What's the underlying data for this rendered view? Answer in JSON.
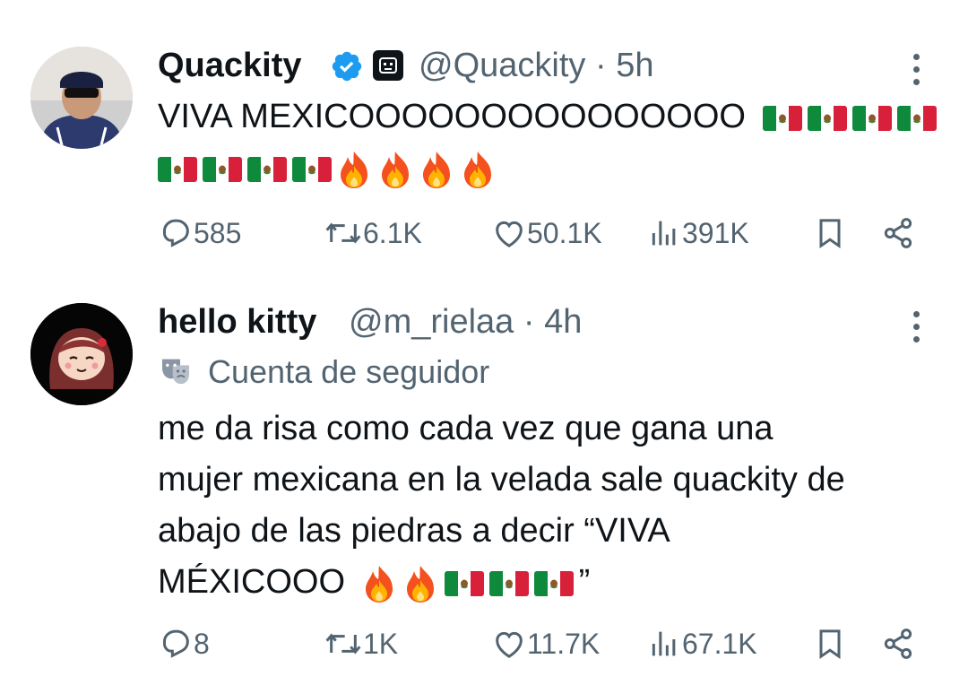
{
  "tweets": [
    {
      "display_name": "Quackity",
      "handle": "@Quackity",
      "time": "5h",
      "text_line1": "VIVA MEXICOOOOOOOOOOOOOOO",
      "flags_line1": 4,
      "flags_line2": 4,
      "fires": 4,
      "stats": {
        "replies": "585",
        "reposts": "6.1K",
        "likes": "50.1K",
        "views": "391K"
      }
    },
    {
      "display_name": "hello kitty",
      "handle": "@m_rielaa",
      "time": "4h",
      "label": "Cuenta de seguidor",
      "text_lines": [
        "me da risa como cada vez que gana una",
        "mujer mexicana en la velada sale quackity de",
        "abajo de las piedras a decir “VIVA"
      ],
      "text_last": "MÉXICOOO",
      "text_end": "”",
      "stats": {
        "replies": "8",
        "reposts": "1K",
        "likes": "11.7K",
        "views": "67.1K"
      }
    }
  ],
  "separator": " · ",
  "colors": {
    "text": "#0f1419",
    "secondary": "#536471",
    "verified": "#1d9bf0"
  },
  "icons": [
    "reply-icon",
    "repost-icon",
    "like-icon",
    "views-icon",
    "bookmark-icon",
    "share-icon",
    "verified-icon",
    "more-icon",
    "parody-mask-icon"
  ]
}
